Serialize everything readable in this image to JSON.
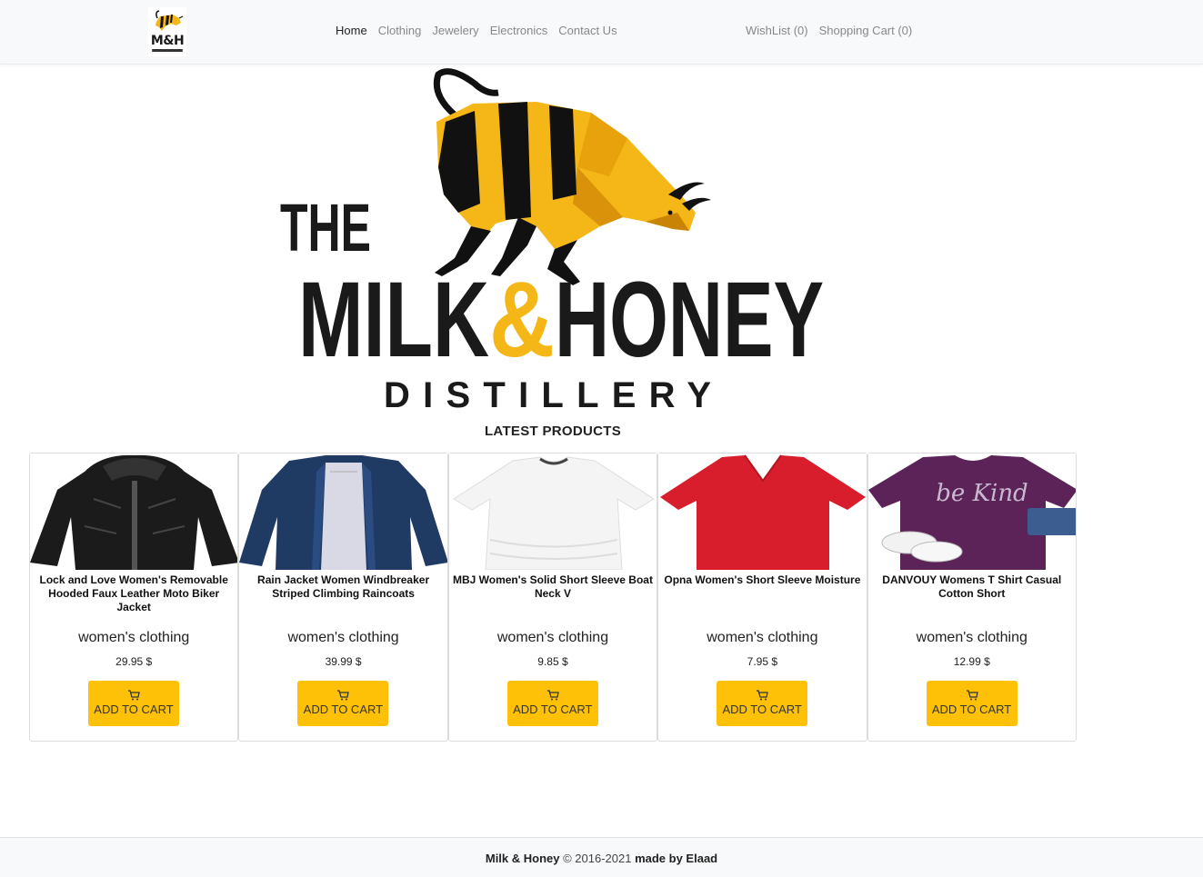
{
  "nav": {
    "logo_text": "M&H",
    "links": [
      "Home",
      "Clothing",
      "Jewelery",
      "Electronics",
      "Contact Us"
    ],
    "wishlist": "WishList (0)",
    "cart": "Shopping Cart (0)"
  },
  "hero": {
    "line1": "THE",
    "milk": "MILK",
    "amp": "&",
    "honey": "HONEY",
    "line3": "DISTILLERY"
  },
  "section_title": "LATEST PRODUCTS",
  "products": [
    {
      "title": "Lock and Love Women's Removable Hooded Faux Leather Moto Biker Jacket",
      "category": "women's clothing",
      "price": "29.95 $",
      "button": "ADD TO CART",
      "image": "black-leather-jacket"
    },
    {
      "title": "Rain Jacket Women Windbreaker Striped Climbing Raincoats",
      "category": "women's clothing",
      "price": "39.99 $",
      "button": "ADD TO CART",
      "image": "navy-raincoat"
    },
    {
      "title": "MBJ Women's Solid Short Sleeve Boat Neck V",
      "category": "women's clothing",
      "price": "9.85 $",
      "button": "ADD TO CART",
      "image": "white-tshirt"
    },
    {
      "title": "Opna Women's Short Sleeve Moisture",
      "category": "women's clothing",
      "price": "7.95 $",
      "button": "ADD TO CART",
      "image": "red-tshirt"
    },
    {
      "title": "DANVOUY Womens T Shirt Casual Cotton Short",
      "category": "women's clothing",
      "price": "12.99 $",
      "button": "ADD TO CART",
      "image": "purple-be-kind-tshirt",
      "shirt_text": "be Kind"
    }
  ],
  "footer": {
    "brand": "Milk & Honey",
    "years": " © 2016-2021 ",
    "credit": "made by Elaad"
  },
  "colors": {
    "accent": "#ffc107",
    "brand_yellow": "#f5b617",
    "nav_bg": "#f8f9fa"
  }
}
